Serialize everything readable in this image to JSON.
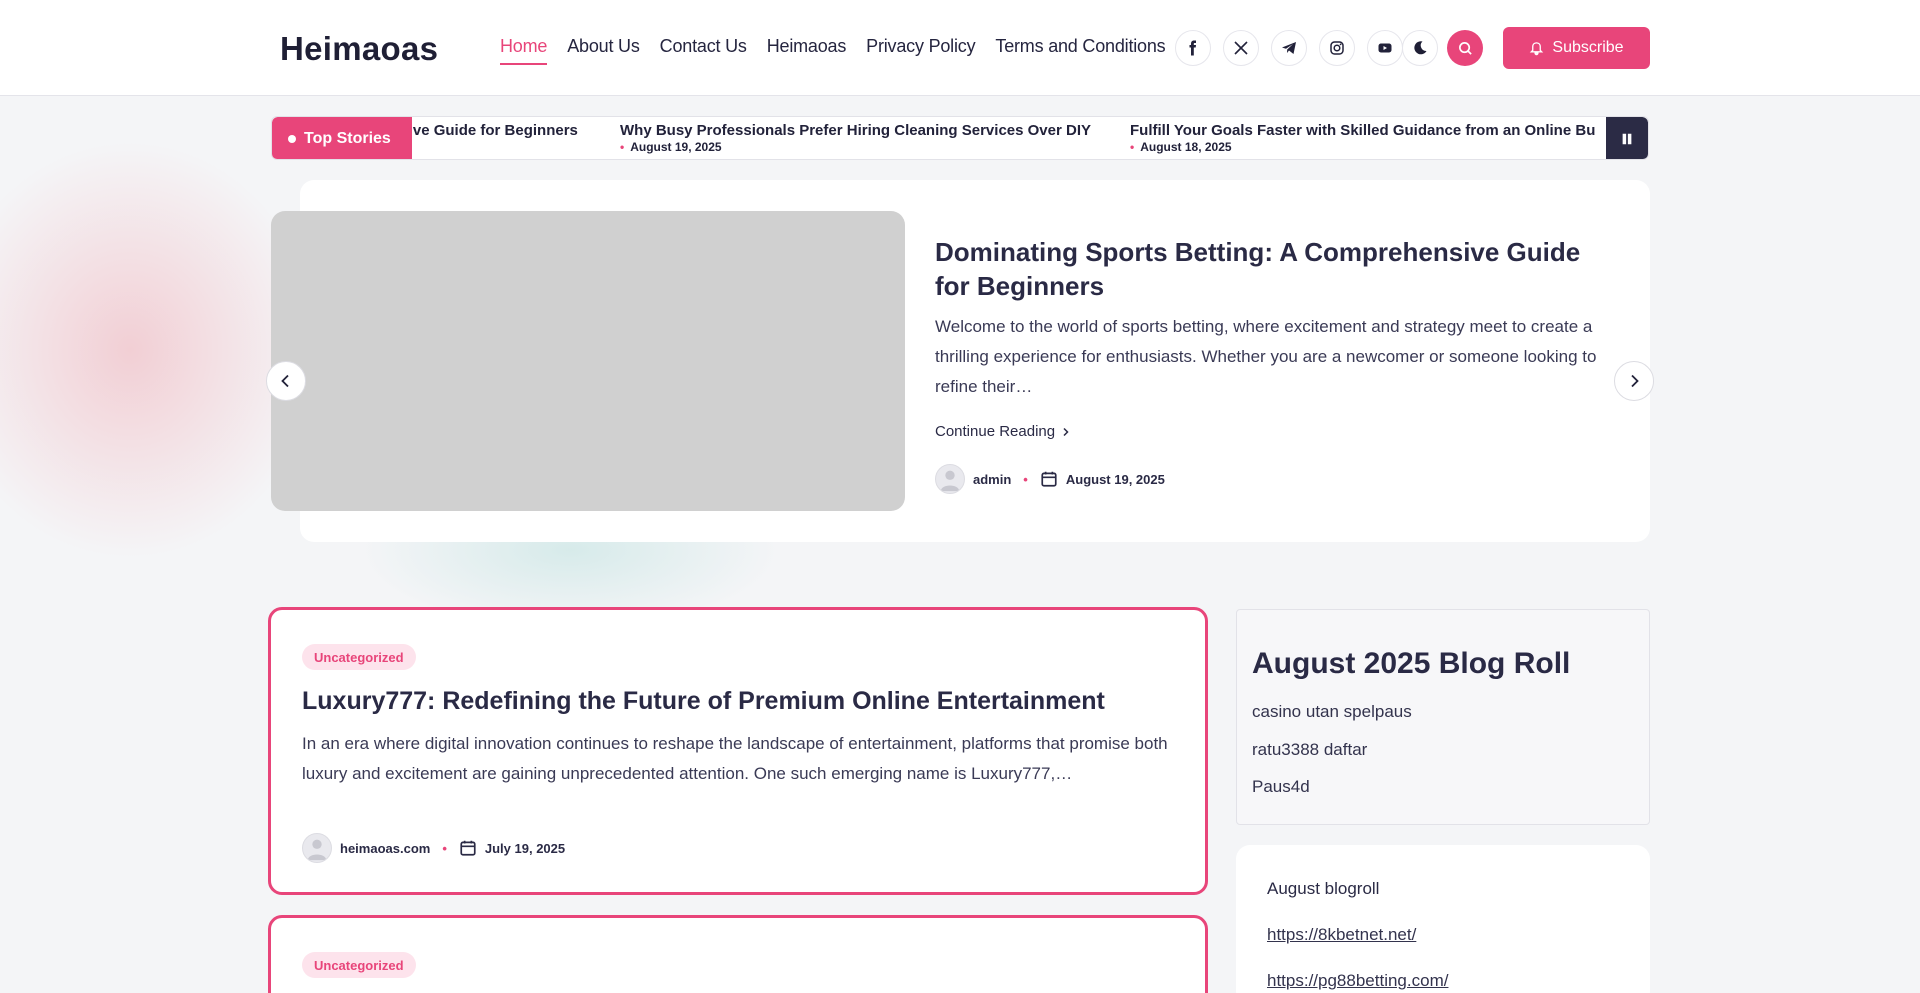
{
  "site": {
    "logo": "Heimaoas"
  },
  "nav": {
    "items": [
      "Home",
      "About Us",
      "Contact Us",
      "Heimaoas",
      "Privacy Policy",
      "Terms and Conditions"
    ],
    "active": "Home"
  },
  "social_icons": [
    "facebook-icon",
    "x-icon",
    "telegram-icon",
    "instagram-icon",
    "youtube-icon"
  ],
  "header": {
    "subscribe_label": "Subscribe"
  },
  "ticker": {
    "label": "Top Stories",
    "items": [
      {
        "title": "Dominating Sports Betting: A Comprehensive Guide for Beginners",
        "visible": "asive Guide for Beginners",
        "date": ""
      },
      {
        "title": "Why Busy Professionals Prefer Hiring Cleaning Services Over DIY",
        "date": "August 19, 2025"
      },
      {
        "title": "Fulfill Your Goals Faster with Skilled Guidance from an Online Bu",
        "date": "August 18, 2025"
      }
    ]
  },
  "hero": {
    "title": "Dominating Sports Betting: A Comprehensive Guide for Beginners",
    "excerpt": "Welcome to the world of sports betting, where excitement and strategy meet to create a thrilling experience for enthusiasts. Whether you are a newcomer or someone looking to refine their…",
    "continue_label": "Continue Reading",
    "author": "admin",
    "date": "August 19, 2025"
  },
  "posts": [
    {
      "category": "Uncategorized",
      "title": "Luxury777: Redefining the Future of Premium Online Entertainment",
      "excerpt": "In an era where digital innovation continues to reshape the landscape of entertainment, platforms that promise both luxury and excitement are gaining unprecedented attention. One such emerging name is Luxury777,…",
      "author": "heimaoas.com",
      "date": "July 19, 2025"
    },
    {
      "category": "Uncategorized"
    }
  ],
  "sidebar": {
    "blogroll_title": "August 2025 Blog Roll",
    "blogroll_items": [
      "casino utan spelpaus",
      "ratu3388 daftar",
      "Paus4d"
    ],
    "widget2_title": "August blogroll",
    "widget2_links": [
      "https://8kbetnet.net/",
      "https://pg88betting.com/"
    ]
  },
  "colors": {
    "accent": "#e8457a",
    "dark": "#2b2b45",
    "placeholder": "#d0d0d0"
  }
}
